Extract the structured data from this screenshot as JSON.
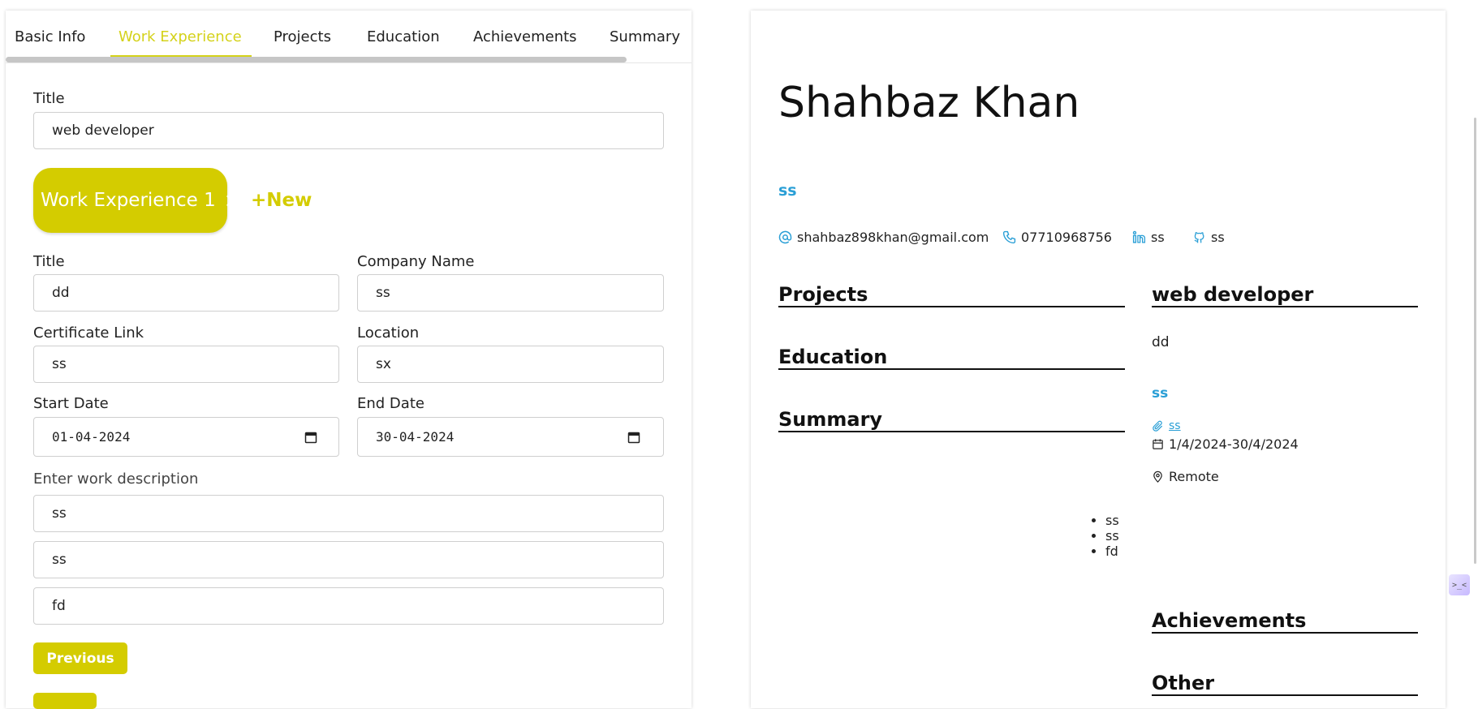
{
  "tabs": [
    "Basic Info",
    "Work Experience",
    "Projects",
    "Education",
    "Achievements",
    "Summary"
  ],
  "editor": {
    "section_title_label": "Title",
    "section_title_value": "web developer",
    "experience_chip": "Work Experience 1",
    "chip_close": "×",
    "new_label": "+New",
    "fields": {
      "title_label": "Title",
      "title_value": "dd",
      "company_label": "Company Name",
      "company_value": "ss",
      "cert_label": "Certificate Link",
      "cert_value": "ss",
      "location_label": "Location",
      "location_value": "sx",
      "start_label": "Start Date",
      "start_value": "01-04-2024",
      "end_label": "End Date",
      "end_value": "30-04-2024"
    },
    "description_label": "Enter work description",
    "descriptions": [
      "ss",
      "ss",
      "fd"
    ],
    "previous_label": "Previous"
  },
  "preview": {
    "name": "Shahbaz Khan",
    "subtitle": "ss",
    "email": "shahbaz898khan@gmail.com",
    "phone": "07710968756",
    "linkedin": "ss",
    "github": "ss",
    "left_sections": [
      "Projects",
      "Education",
      "Summary"
    ],
    "work_heading": "web developer",
    "work_title": "dd",
    "work_company": "ss",
    "work_link": "ss",
    "work_dates": "1/4/2024-30/4/2024",
    "work_location": "Remote",
    "work_bullets": [
      "ss",
      "ss",
      "fd"
    ],
    "achievements_heading": "Achievements",
    "other_heading": "Other"
  },
  "colors": {
    "accent": "#d4cc00",
    "tab_active": "#d4d21a",
    "link": "#2a9fd6"
  }
}
